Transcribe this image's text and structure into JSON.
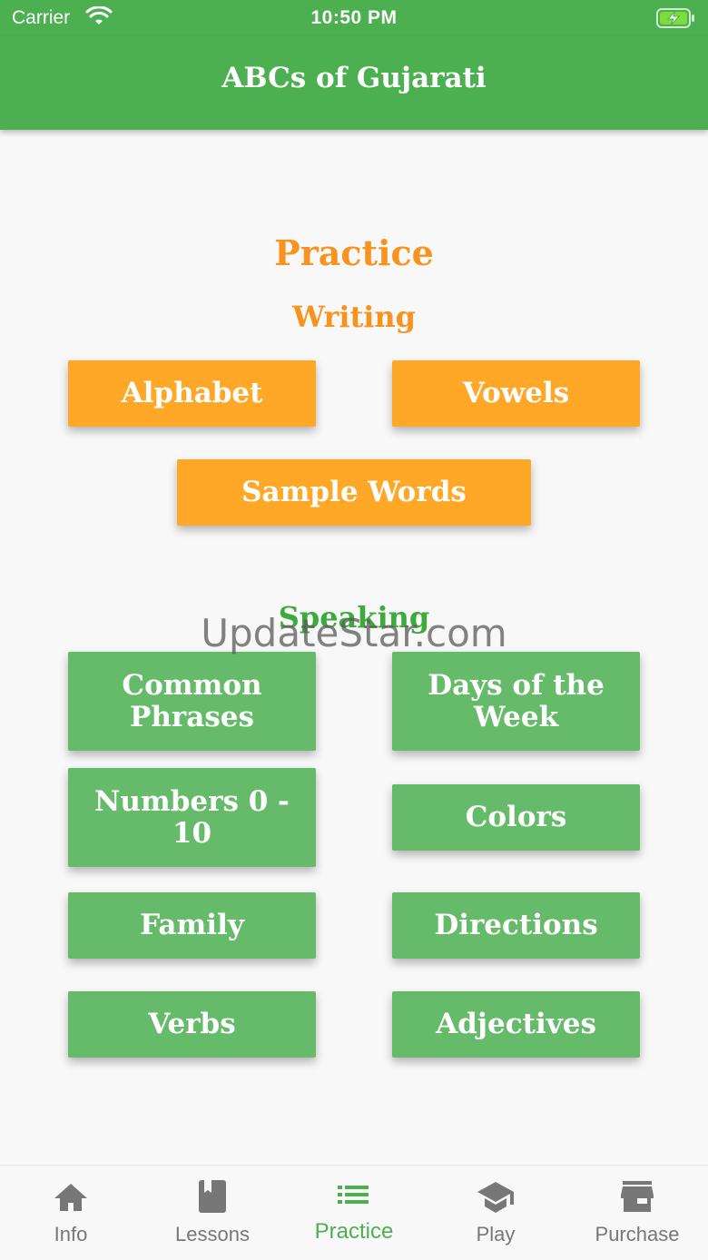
{
  "status_bar": {
    "carrier": "Carrier",
    "time": "10:50 PM"
  },
  "app_bar": {
    "title": "ABCs of Gujarati"
  },
  "practice": {
    "heading": "Practice",
    "writing": {
      "heading": "Writing",
      "buttons": [
        "Alphabet",
        "Vowels",
        "Sample Words"
      ]
    },
    "speaking": {
      "heading": "Speaking",
      "buttons": [
        "Common Phrases",
        "Days of the Week",
        "Numbers 0 - 10",
        "Colors",
        "Family",
        "Directions",
        "Verbs",
        "Adjectives"
      ]
    }
  },
  "watermark": "UpdateStar.com",
  "tab_bar": {
    "tabs": [
      {
        "label": "Info",
        "icon": "home-icon"
      },
      {
        "label": "Lessons",
        "icon": "book-icon"
      },
      {
        "label": "Practice",
        "icon": "list-icon",
        "active": true
      },
      {
        "label": "Play",
        "icon": "school-icon"
      },
      {
        "label": "Purchase",
        "icon": "store-icon"
      }
    ]
  },
  "colors": {
    "primary": "#4caf50",
    "accent_orange": "#ffa726",
    "heading_orange": "#f7931e",
    "button_green": "#66bb6a",
    "speaking_heading_green": "#3caa3c"
  }
}
